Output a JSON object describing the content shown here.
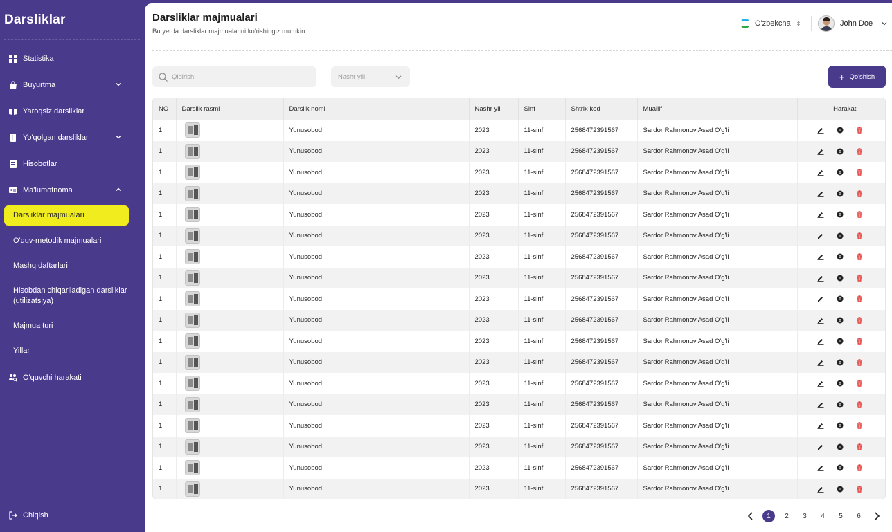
{
  "app": {
    "brand": "Darsliklar"
  },
  "sidebar": {
    "items": [
      {
        "label": "Statistika"
      },
      {
        "label": "Buyurtma"
      },
      {
        "label": "Yaroqsiz darsliklar"
      },
      {
        "label": "Yo'qolgan darsliklar"
      },
      {
        "label": "Hisobotlar"
      },
      {
        "label": "Ma'lumotnoma"
      }
    ],
    "sub_items": [
      {
        "label": "Darsliklar majmualari"
      },
      {
        "label": "O'quv-metodik majmualari"
      },
      {
        "label": "Mashq daftarlari"
      },
      {
        "label": "Hisobdan chiqariladigan darsliklar (utilizatsiya)"
      },
      {
        "label": "Majmua turi"
      },
      {
        "label": "Yillar"
      }
    ],
    "extra_item": {
      "label": "O'quvchi harakati"
    },
    "logout_label": "Chiqish"
  },
  "header": {
    "title": "Darsliklar majmualari",
    "subtitle": "Bu yerda darsliklar majmualarini ko'rishingiz mumkin",
    "language": "O'zbekcha",
    "user_name": "John Doe"
  },
  "toolbar": {
    "search_placeholder": "Qidirish",
    "year_select_placeholder": "Nashr yili",
    "add_label": "Qo'shish"
  },
  "table": {
    "columns": [
      "NO",
      "Darslik rasmi",
      "Darslik nomi",
      "Nashr yili",
      "Sinf",
      "Shtrix kod",
      "Muallif",
      "Harakat"
    ],
    "rows": [
      {
        "no": "1",
        "name": "Yunusobod",
        "year": "2023",
        "grade": "11-sinf",
        "barcode": "2568472391567",
        "author": "Sardor Rahmonov Asad O'g'li"
      },
      {
        "no": "1",
        "name": "Yunusobod",
        "year": "2023",
        "grade": "11-sinf",
        "barcode": "2568472391567",
        "author": "Sardor Rahmonov Asad O'g'li"
      },
      {
        "no": "1",
        "name": "Yunusobod",
        "year": "2023",
        "grade": "11-sinf",
        "barcode": "2568472391567",
        "author": "Sardor Rahmonov Asad O'g'li"
      },
      {
        "no": "1",
        "name": "Yunusobod",
        "year": "2023",
        "grade": "11-sinf",
        "barcode": "2568472391567",
        "author": "Sardor Rahmonov Asad O'g'li"
      },
      {
        "no": "1",
        "name": "Yunusobod",
        "year": "2023",
        "grade": "11-sinf",
        "barcode": "2568472391567",
        "author": "Sardor Rahmonov Asad O'g'li"
      },
      {
        "no": "1",
        "name": "Yunusobod",
        "year": "2023",
        "grade": "11-sinf",
        "barcode": "2568472391567",
        "author": "Sardor Rahmonov Asad O'g'li"
      },
      {
        "no": "1",
        "name": "Yunusobod",
        "year": "2023",
        "grade": "11-sinf",
        "barcode": "2568472391567",
        "author": "Sardor Rahmonov Asad O'g'li"
      },
      {
        "no": "1",
        "name": "Yunusobod",
        "year": "2023",
        "grade": "11-sinf",
        "barcode": "2568472391567",
        "author": "Sardor Rahmonov Asad O'g'li"
      },
      {
        "no": "1",
        "name": "Yunusobod",
        "year": "2023",
        "grade": "11-sinf",
        "barcode": "2568472391567",
        "author": "Sardor Rahmonov Asad O'g'li"
      },
      {
        "no": "1",
        "name": "Yunusobod",
        "year": "2023",
        "grade": "11-sinf",
        "barcode": "2568472391567",
        "author": "Sardor Rahmonov Asad O'g'li"
      },
      {
        "no": "1",
        "name": "Yunusobod",
        "year": "2023",
        "grade": "11-sinf",
        "barcode": "2568472391567",
        "author": "Sardor Rahmonov Asad O'g'li"
      },
      {
        "no": "1",
        "name": "Yunusobod",
        "year": "2023",
        "grade": "11-sinf",
        "barcode": "2568472391567",
        "author": "Sardor Rahmonov Asad O'g'li"
      },
      {
        "no": "1",
        "name": "Yunusobod",
        "year": "2023",
        "grade": "11-sinf",
        "barcode": "2568472391567",
        "author": "Sardor Rahmonov Asad O'g'li"
      },
      {
        "no": "1",
        "name": "Yunusobod",
        "year": "2023",
        "grade": "11-sinf",
        "barcode": "2568472391567",
        "author": "Sardor Rahmonov Asad O'g'li"
      },
      {
        "no": "1",
        "name": "Yunusobod",
        "year": "2023",
        "grade": "11-sinf",
        "barcode": "2568472391567",
        "author": "Sardor Rahmonov Asad O'g'li"
      },
      {
        "no": "1",
        "name": "Yunusobod",
        "year": "2023",
        "grade": "11-sinf",
        "barcode": "2568472391567",
        "author": "Sardor Rahmonov Asad O'g'li"
      },
      {
        "no": "1",
        "name": "Yunusobod",
        "year": "2023",
        "grade": "11-sinf",
        "barcode": "2568472391567",
        "author": "Sardor Rahmonov Asad O'g'li"
      },
      {
        "no": "1",
        "name": "Yunusobod",
        "year": "2023",
        "grade": "11-sinf",
        "barcode": "2568472391567",
        "author": "Sardor Rahmonov Asad O'g'li"
      }
    ]
  },
  "pagination": {
    "pages": [
      "1",
      "2",
      "3",
      "4",
      "5",
      "6"
    ],
    "current": "1"
  },
  "colors": {
    "primary": "#4a3a8c",
    "active_item": "#f0ec1d",
    "delete": "#e53935"
  },
  "icons": {
    "row_actions": [
      "edit-icon",
      "view-icon",
      "delete-icon"
    ]
  }
}
